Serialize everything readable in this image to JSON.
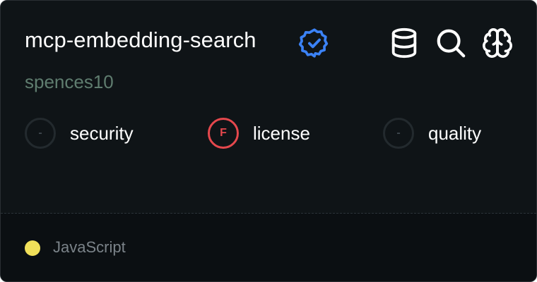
{
  "repo": {
    "name": "mcp-embedding-search",
    "owner": "spences10",
    "verified_icon": "verified-badge-icon",
    "accent_color": "#3b82f6"
  },
  "toolbar": {
    "icons": [
      "database-icon",
      "search-icon",
      "brain-icon"
    ]
  },
  "scores": [
    {
      "grade": "-",
      "label": "security",
      "state": "empty"
    },
    {
      "grade": "F",
      "label": "license",
      "state": "fail",
      "color": "#e5484d"
    },
    {
      "grade": "-",
      "label": "quality",
      "state": "empty"
    }
  ],
  "footer": {
    "language": "JavaScript",
    "language_color": "#f1e05a"
  }
}
